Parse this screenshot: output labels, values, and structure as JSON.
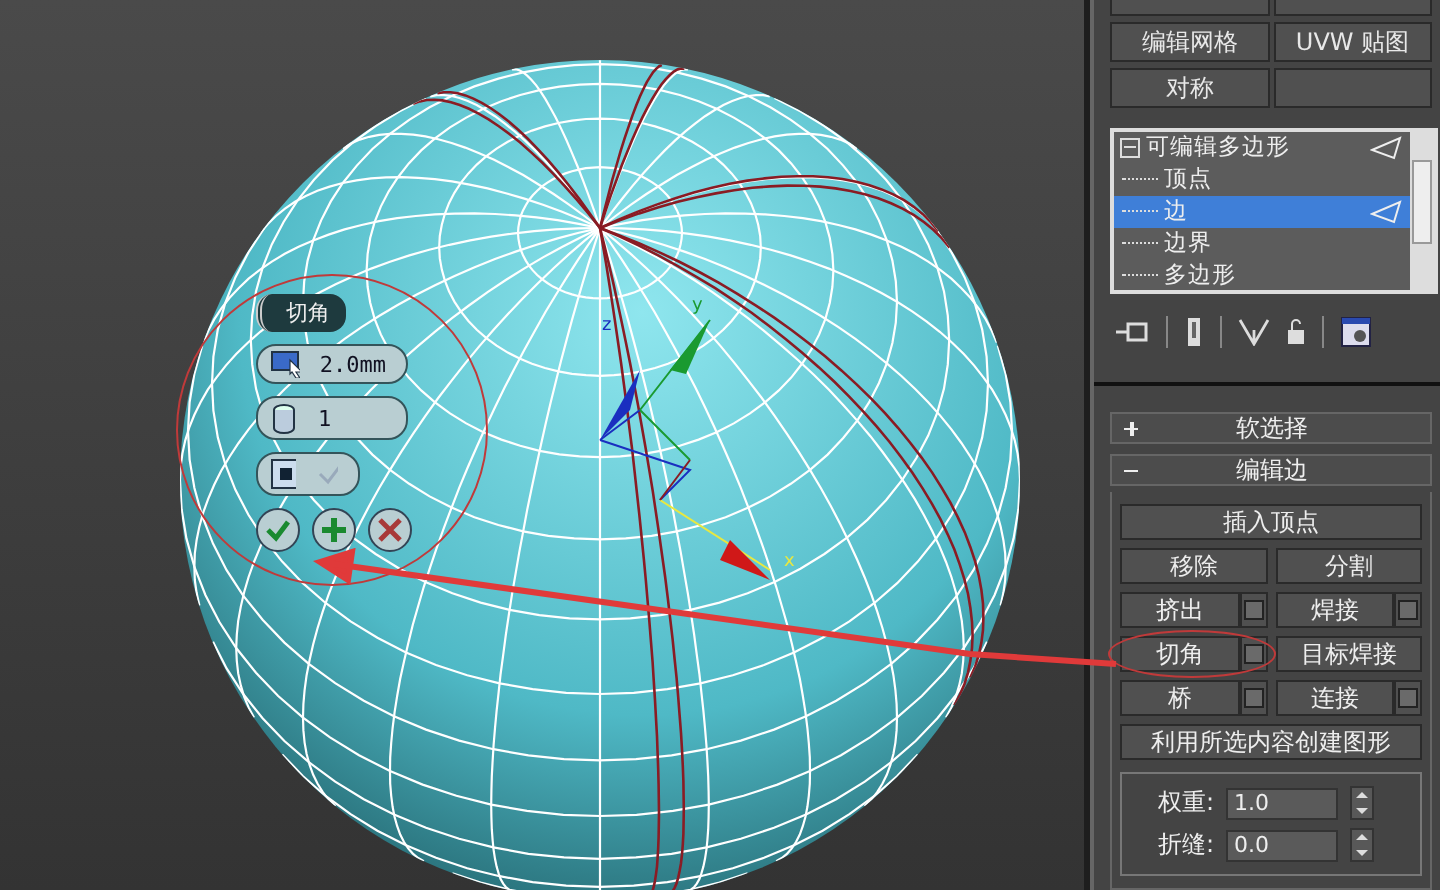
{
  "viewport": {
    "caddy": {
      "title": "切角",
      "fields": [
        {
          "kind": "amount",
          "value": "2.0mm"
        },
        {
          "kind": "segments",
          "value": "1"
        }
      ]
    },
    "gizmo": {
      "z_label": "z",
      "y_label": "y",
      "x_label": "x"
    }
  },
  "command_panel": {
    "modifier_buttons": [
      [
        "编辑网格",
        "UVW 贴图"
      ],
      [
        "对称"
      ]
    ],
    "stack": {
      "label": "可编辑多边形",
      "expanded": true,
      "children": [
        {
          "label": "顶点",
          "selected": false
        },
        {
          "label": "边",
          "selected": true
        },
        {
          "label": "边界",
          "selected": false
        },
        {
          "label": "多边形",
          "selected": false
        }
      ]
    },
    "rollouts": [
      {
        "title": "软选择",
        "expanded": false
      },
      {
        "title": "编辑边",
        "expanded": true
      }
    ],
    "edit_edges": [
      [
        {
          "label": "插入顶点",
          "settings": false,
          "annotated": false
        }
      ],
      [
        {
          "label": "移除",
          "settings": false,
          "annotated": false
        },
        {
          "label": "分割",
          "settings": false,
          "annotated": false
        }
      ],
      [
        {
          "label": "挤出",
          "settings": true,
          "annotated": false
        },
        {
          "label": "焊接",
          "settings": true,
          "annotated": false
        }
      ],
      [
        {
          "label": "切角",
          "settings": true,
          "annotated": true
        },
        {
          "label": "目标焊接",
          "settings": false,
          "annotated": false
        }
      ],
      [
        {
          "label": "桥",
          "settings": true,
          "annotated": false
        },
        {
          "label": "连接",
          "settings": true,
          "annotated": false
        }
      ],
      [
        {
          "label": "利用所选内容创建图形",
          "settings": false,
          "annotated": false
        }
      ]
    ],
    "fields": [
      {
        "label": "权重:",
        "value": "1.0"
      },
      {
        "label": "折缝:",
        "value": "0.0"
      }
    ]
  }
}
